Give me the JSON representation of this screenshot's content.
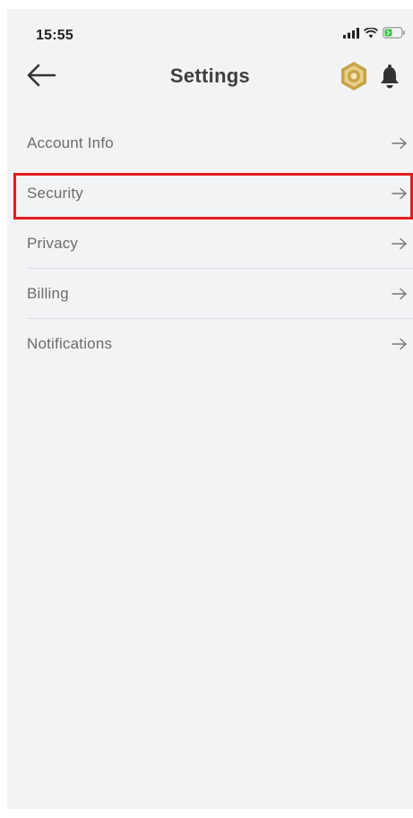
{
  "status_bar": {
    "time": "15:55",
    "icons": [
      "signal-icon",
      "wifi-icon",
      "battery-icon"
    ]
  },
  "header": {
    "title": "Settings",
    "back_icon": "back-arrow-icon",
    "coin_icon": "coin-icon",
    "bell_icon": "bell-icon"
  },
  "settings": {
    "items": [
      {
        "label": "Account Info",
        "icon": "arrow-right-icon"
      },
      {
        "label": "Security",
        "icon": "arrow-right-icon",
        "highlighted": true
      },
      {
        "label": "Privacy",
        "icon": "arrow-right-icon"
      },
      {
        "label": "Billing",
        "icon": "arrow-right-icon"
      },
      {
        "label": "Notifications",
        "icon": "arrow-right-icon"
      }
    ]
  },
  "colors": {
    "background": "#f2f3f5",
    "highlight": "#e21b1b",
    "coin": "#c8a24a",
    "text": "#6c6c6c"
  }
}
